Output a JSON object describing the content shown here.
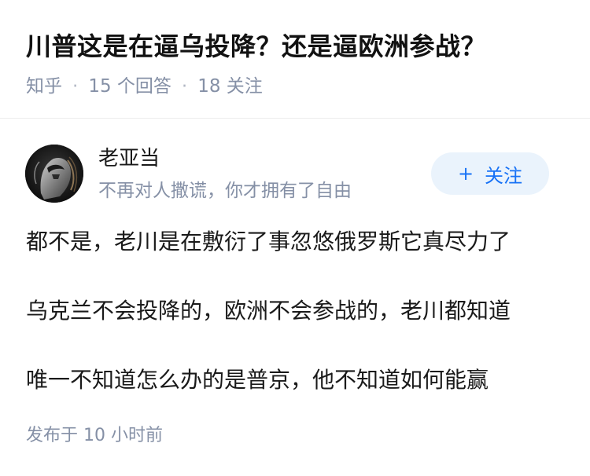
{
  "question": {
    "title": "川普这是在逼乌投降？还是逼欧洲参战？",
    "source": "知乎",
    "answer_count": "15 个回答",
    "follower_count": "18 关注"
  },
  "author": {
    "name": "老亚当",
    "bio": "不再对人撒谎，你才拥有了自由",
    "avatar_icon": "avatar-image",
    "follow_label": "关注",
    "follow_icon": "plus-icon"
  },
  "answer": {
    "paragraphs": [
      "都不是，老川是在敷衍了事忽悠俄罗斯它真尽力了",
      "乌克兰不会投降的，欧洲不会参战的，老川都知道",
      "唯一不知道怎么办的是普京，他不知道如何能赢"
    ],
    "published": "发布于  10 小时前"
  },
  "colors": {
    "accent": "#1772f6",
    "follow_bg": "#eaf3fc",
    "meta_text": "#8590a6"
  }
}
